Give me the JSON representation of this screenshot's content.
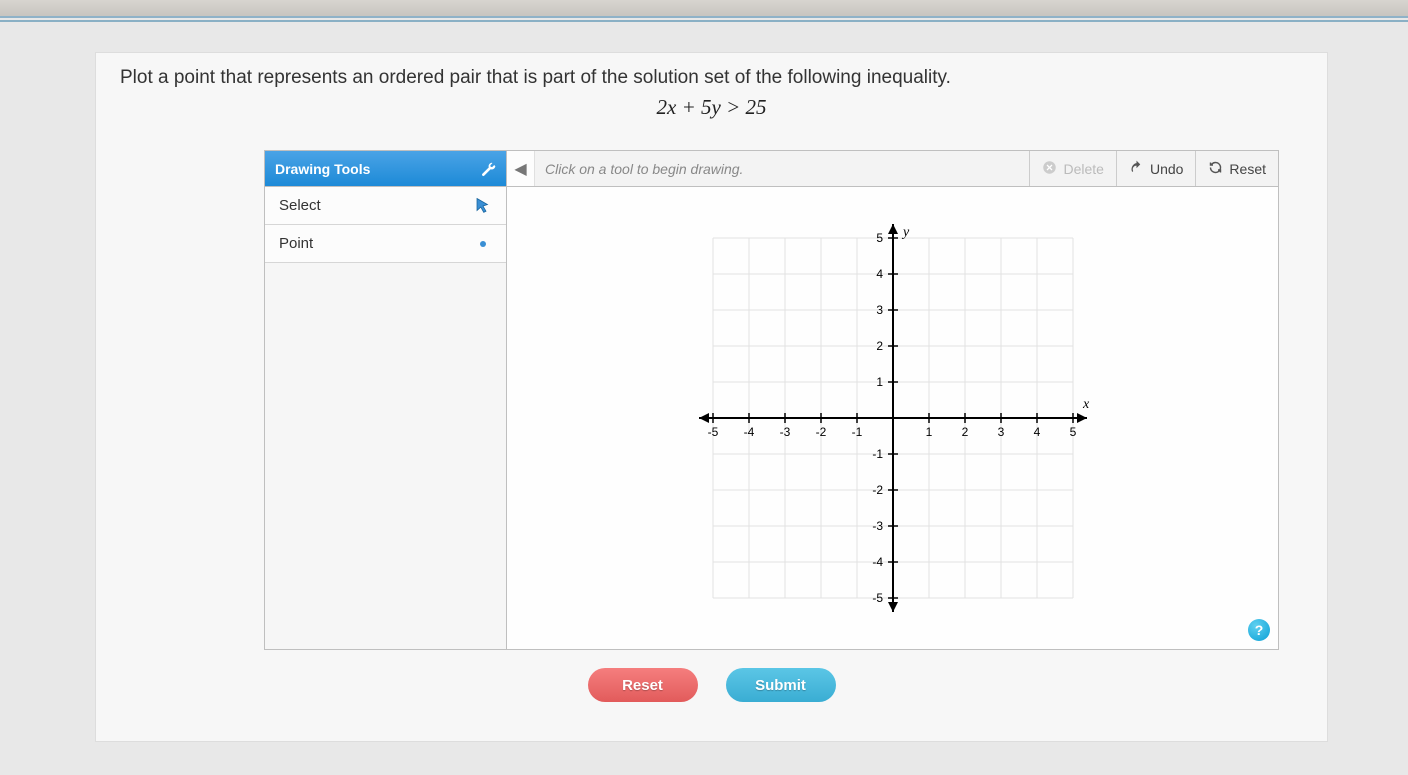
{
  "prompt": "Plot a point that represents an ordered pair that is part of the solution set of the following inequality.",
  "equation": "2x + 5y > 25",
  "toolbar": {
    "header": "Drawing Tools",
    "hint": "Click on a tool to begin drawing.",
    "delete": "Delete",
    "undo": "Undo",
    "reset": "Reset"
  },
  "tools": {
    "select": "Select",
    "point": "Point"
  },
  "footer": {
    "reset": "Reset",
    "submit": "Submit"
  },
  "help": "?",
  "chart_data": {
    "type": "scatter",
    "title": "",
    "xlabel": "x",
    "ylabel": "y",
    "xlim": [
      -5,
      5
    ],
    "ylim": [
      -5,
      5
    ],
    "x_ticks": [
      -5,
      -4,
      -3,
      -2,
      -1,
      1,
      2,
      3,
      4,
      5
    ],
    "y_ticks": [
      -5,
      -4,
      -3,
      -2,
      -1,
      1,
      2,
      3,
      4,
      5
    ],
    "series": [
      {
        "name": "plotted points",
        "values": []
      }
    ]
  }
}
